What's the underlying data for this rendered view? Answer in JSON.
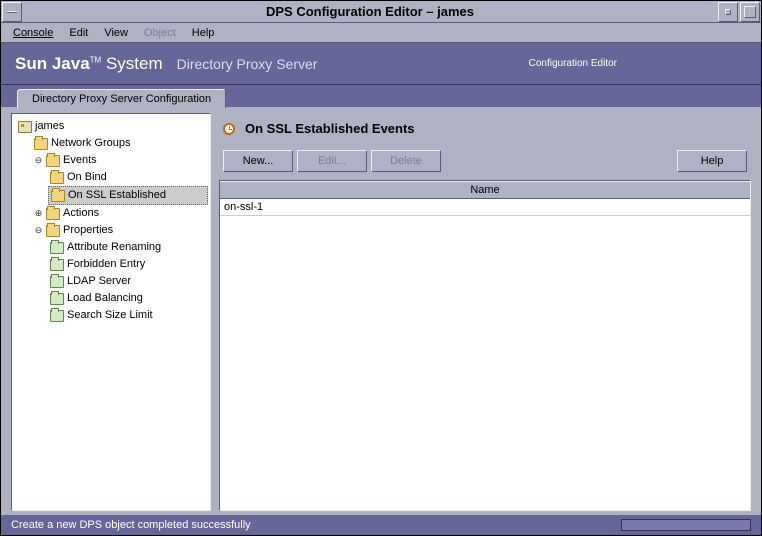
{
  "window": {
    "title": "DPS Configuration Editor – james"
  },
  "menubar": {
    "console": "Console",
    "edit": "Edit",
    "view": "View",
    "object": "Object",
    "help": "Help"
  },
  "banner": {
    "brand_pre": "Sun Java",
    "brand_tm": "TM",
    "brand_post": " System",
    "product": "Directory Proxy Server",
    "conf": "Configuration Editor"
  },
  "tab": {
    "label": "Directory Proxy Server Configuration"
  },
  "tree": {
    "root": "james",
    "network_groups": "Network Groups",
    "events": "Events",
    "on_bind": "On Bind",
    "on_ssl": "On SSL Established",
    "actions": "Actions",
    "properties": "Properties",
    "attr_renaming": "Attribute Renaming",
    "forbidden_entry": "Forbidden Entry",
    "ldap_server": "LDAP Server",
    "load_balancing": "Load Balancing",
    "search_size_limit": "Search Size Limit"
  },
  "main": {
    "title": "On SSL Established Events",
    "buttons": {
      "new": "New...",
      "edit": "Edit...",
      "delete": "Delete",
      "help": "Help"
    },
    "list": {
      "header": "Name",
      "rows": [
        "on-ssl-1"
      ]
    }
  },
  "status": {
    "message": "Create a new DPS object completed successfully"
  }
}
